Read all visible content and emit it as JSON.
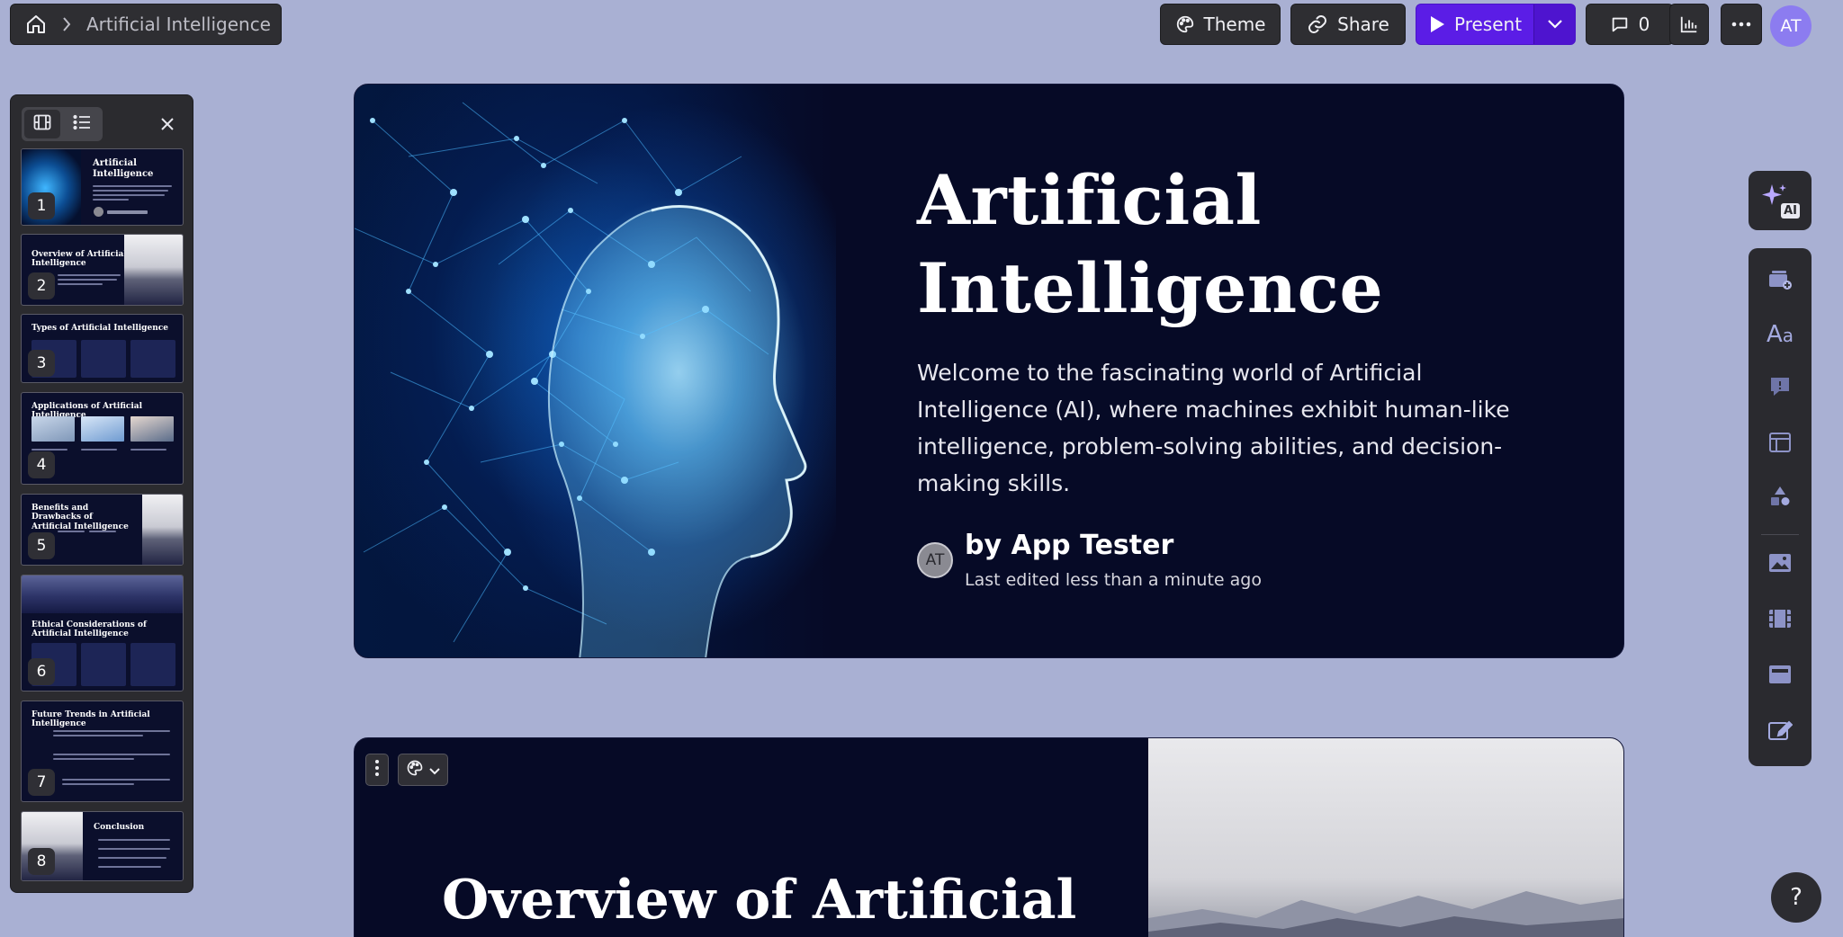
{
  "breadcrumb": {
    "home_icon": "home-icon",
    "separator_icon": "chevron-right-icon",
    "current": "Artificial Intelligence"
  },
  "toolbar": {
    "theme_label": "Theme",
    "share_label": "Share",
    "present_label": "Present",
    "comment_count": "0",
    "avatar_initials": "AT",
    "accent_color": "#5b1de6"
  },
  "thumbnails": [
    {
      "number": "1",
      "title": "Artificial Intelligence"
    },
    {
      "number": "2",
      "title": "Overview of Artificial Intelligence"
    },
    {
      "number": "3",
      "title": "Types of Artificial Intelligence"
    },
    {
      "number": "4",
      "title": "Applications of Artificial Intelligence"
    },
    {
      "number": "5",
      "title": "Benefits and Drawbacks of Artificial Intelligence"
    },
    {
      "number": "6",
      "title": "Ethical Considerations of Artificial Intelligence"
    },
    {
      "number": "7",
      "title": "Future Trends in Artificial Intelligence"
    },
    {
      "number": "8",
      "title": "Conclusion"
    }
  ],
  "slide1": {
    "title_line1": "Artificial",
    "title_line2": "Intelligence",
    "subtitle": "Welcome to the fascinating world of Artificial Intelligence (AI), where machines exhibit human-like intelligence, problem-solving abilities, and decision-making skills.",
    "author_initials": "AT",
    "author": "by App Tester",
    "edited": "Last edited less than a minute ago"
  },
  "slide2": {
    "title": "Overview of Artificial"
  },
  "right_toolbar": {
    "ai_badge": "AI",
    "items": [
      "add-card-icon",
      "text-style-icon",
      "callout-icon",
      "layout-icon",
      "shapes-icon",
      "image-icon",
      "video-icon",
      "embed-icon",
      "edit-icon"
    ]
  },
  "help_label": "?"
}
